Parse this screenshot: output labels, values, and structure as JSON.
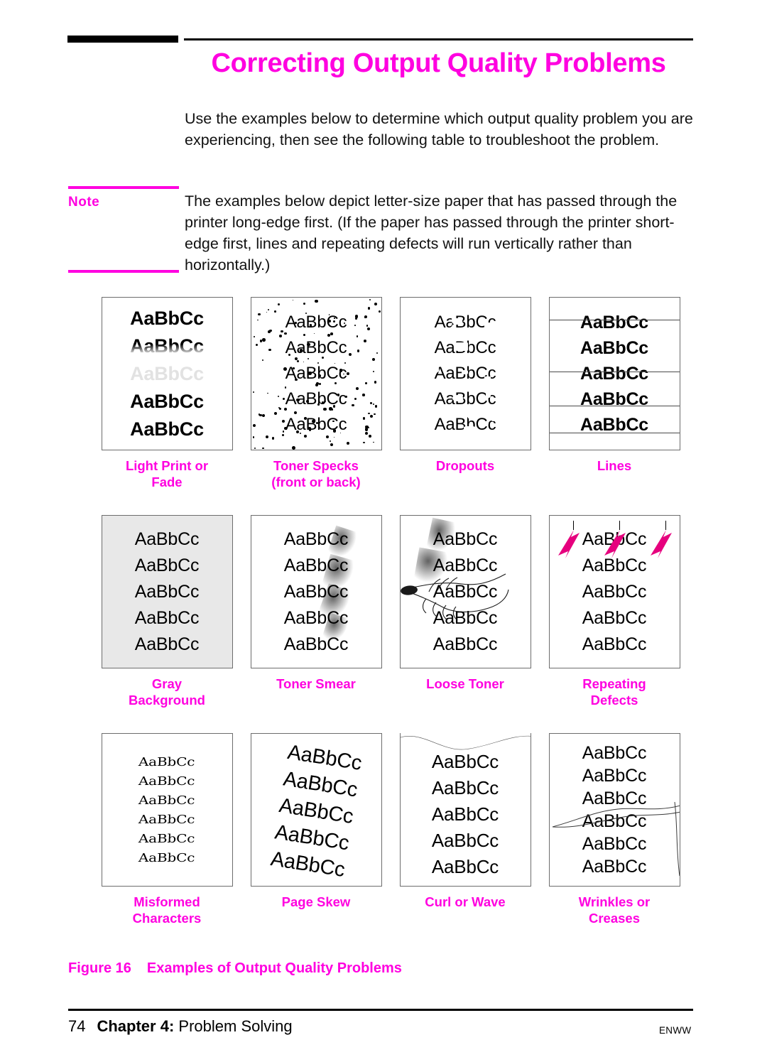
{
  "header": {
    "title": "Correcting Output Quality Problems",
    "accent_color": "#ff00e0"
  },
  "intro": {
    "text": "Use the examples below to determine which output quality problem you are experiencing, then see the following table to troubleshoot the problem."
  },
  "note": {
    "label": "Note",
    "text": "The examples below depict letter-size paper that has passed through the printer long-edge first. (If the paper has passed through the printer short-edge first, lines and repeating defects will run vertically rather than horizontally.)"
  },
  "figure": {
    "number": "Figure 16",
    "title": "Examples of Output Quality Problems",
    "sample_text": "AaBbCc",
    "samples": [
      {
        "id": "light-print-or-fade",
        "label_line1": "Light Print or",
        "label_line2": "Fade"
      },
      {
        "id": "toner-specks",
        "label_line1": "Toner Specks",
        "label_line2": "(front or back)"
      },
      {
        "id": "dropouts",
        "label_line1": "Dropouts",
        "label_line2": ""
      },
      {
        "id": "lines",
        "label_line1": "Lines",
        "label_line2": ""
      },
      {
        "id": "gray-background",
        "label_line1": "Gray",
        "label_line2": "Background"
      },
      {
        "id": "toner-smear",
        "label_line1": "Toner Smear",
        "label_line2": ""
      },
      {
        "id": "loose-toner",
        "label_line1": "Loose Toner",
        "label_line2": ""
      },
      {
        "id": "repeating-defects",
        "label_line1": "Repeating",
        "label_line2": "Defects"
      },
      {
        "id": "misformed-characters",
        "label_line1": "Misformed",
        "label_line2": "Characters"
      },
      {
        "id": "page-skew",
        "label_line1": "Page Skew",
        "label_line2": ""
      },
      {
        "id": "curl-or-wave",
        "label_line1": "Curl or Wave",
        "label_line2": ""
      },
      {
        "id": "wrinkles-or-creases",
        "label_line1": "Wrinkles or",
        "label_line2": "Creases"
      }
    ]
  },
  "footer": {
    "page_number": "74",
    "chapter": "Chapter 4:",
    "section": "Problem Solving",
    "right_code": "ENWW"
  }
}
